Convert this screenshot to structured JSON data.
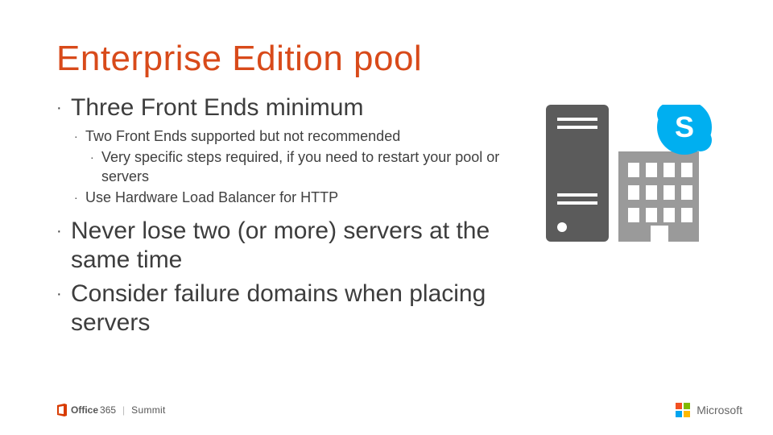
{
  "title": "Enterprise Edition pool",
  "bullets": {
    "b1": "Three Front Ends minimum",
    "b1a": "Two Front Ends supported but not recommended",
    "b1a1": "Very specific steps required, if you need to restart your pool or servers",
    "b1b": "Use Hardware Load Balancer for HTTP",
    "b2": "Never lose two (or more) servers at the same time",
    "b3": "Consider failure domains when placing servers"
  },
  "footer": {
    "office": "Office",
    "threesixtyfive": "365",
    "summit": "Summit",
    "microsoft": "Microsoft"
  },
  "icons": {
    "server": "server-icon",
    "building": "building-icon",
    "skype": "skype-icon",
    "office": "office-icon",
    "mslogo": "microsoft-logo-icon"
  }
}
